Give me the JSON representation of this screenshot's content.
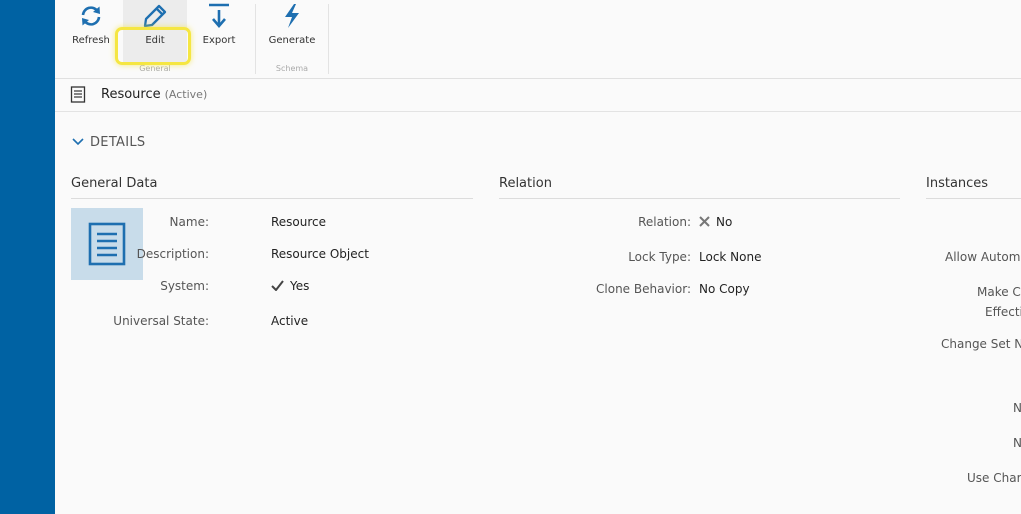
{
  "toolbar": {
    "refresh_label": "Refresh",
    "edit_label": "Edit",
    "export_label": "Export",
    "generate_label": "Generate",
    "group_general": "General",
    "group_schema": "Schema"
  },
  "header": {
    "title": "Resource",
    "state": "(Active)"
  },
  "details": {
    "title": "DETAILS",
    "general": {
      "title": "General Data",
      "fields": [
        {
          "label": "Name:",
          "value": "Resource"
        },
        {
          "label": "Description:",
          "value": "Resource Object"
        },
        {
          "label": "System:",
          "value": "Yes"
        },
        {
          "label": "Universal State:",
          "value": "Active"
        }
      ]
    },
    "relation": {
      "title": "Relation",
      "fields": [
        {
          "label": "Relation:",
          "value": "No"
        },
        {
          "label": "Lock Type:",
          "value": "Lock None"
        },
        {
          "label": "Clone Behavior:",
          "value": "No Copy"
        }
      ]
    },
    "instances": {
      "title": "Instances",
      "labels": [
        "Allow Autom",
        "Make C",
        "Effecti",
        "Change Set N",
        "N",
        "N",
        "Use Char"
      ]
    }
  },
  "colors": {
    "sidebar": "#0062a3",
    "icon": "#1e6fb0",
    "highlight": "#f5e642"
  }
}
